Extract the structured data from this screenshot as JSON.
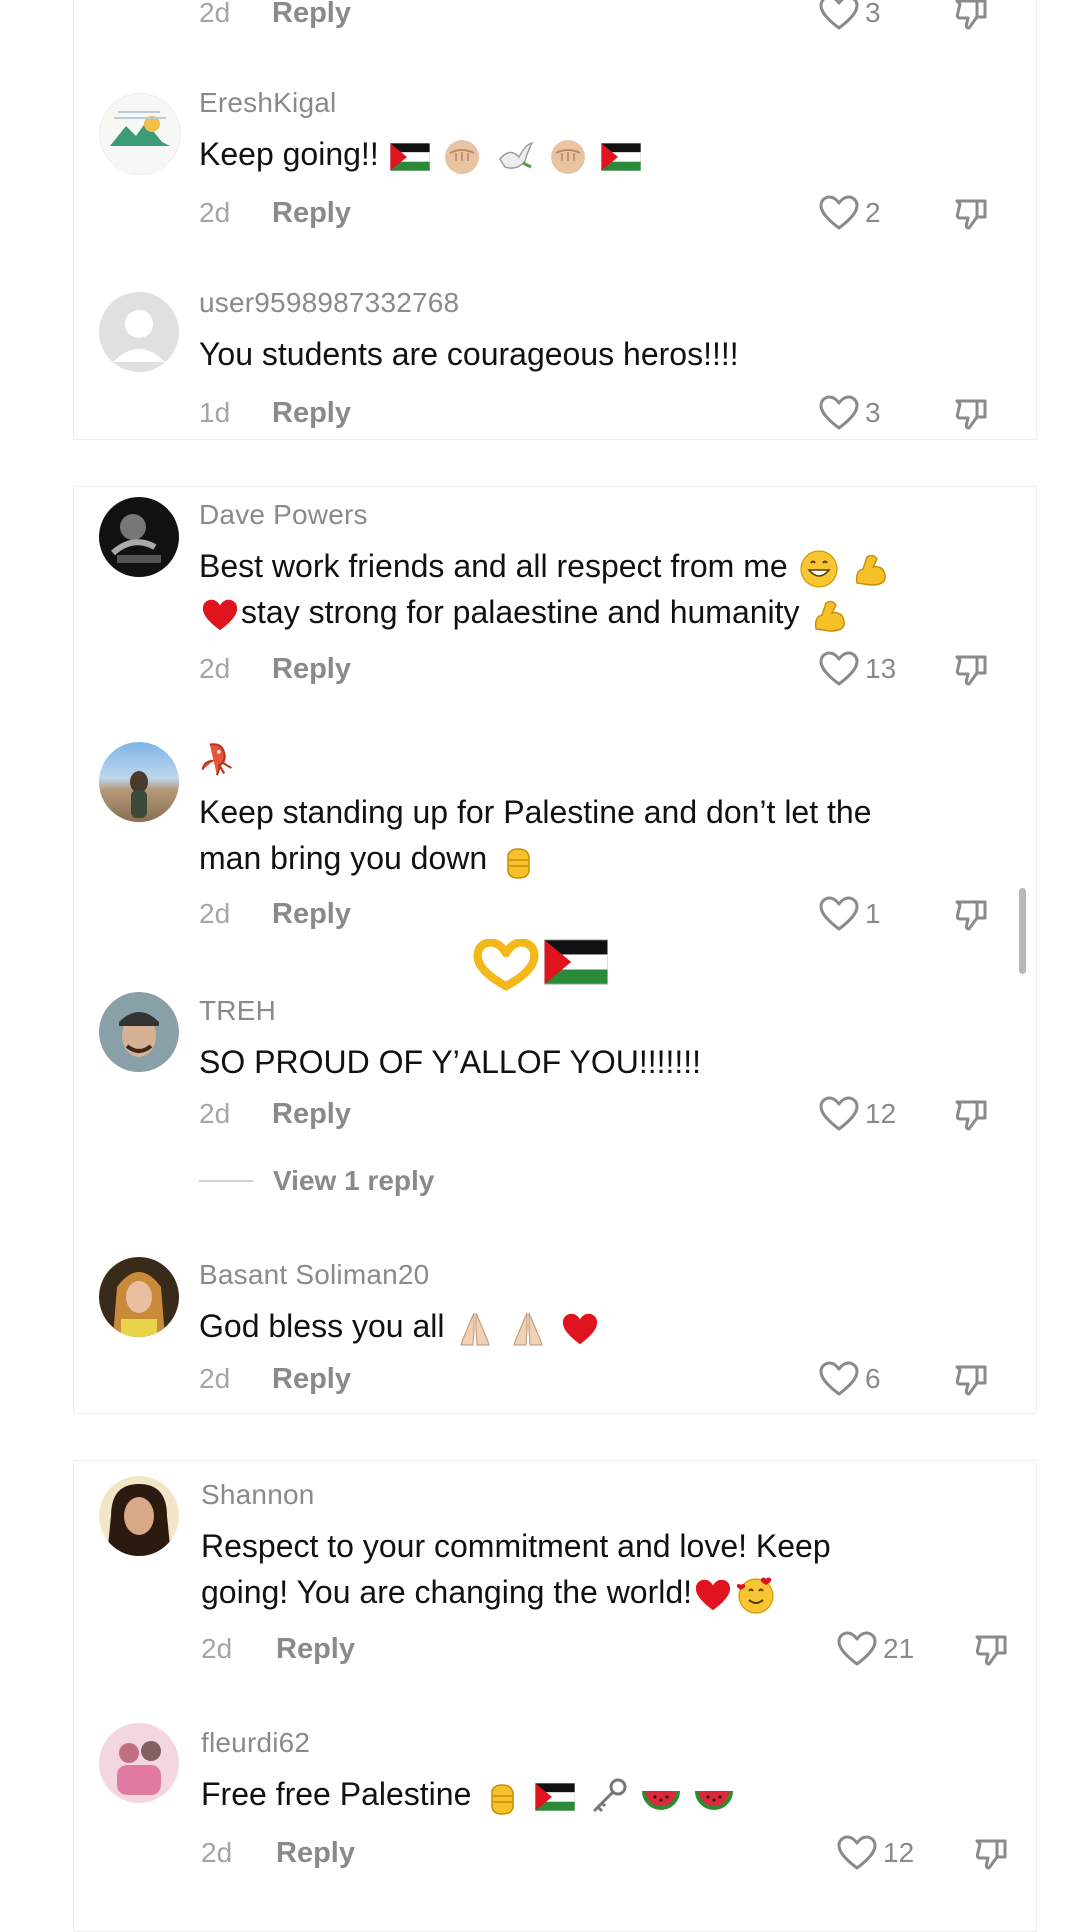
{
  "comments": [
    {
      "date": "2d",
      "reply": "Reply",
      "likes": "3"
    },
    {
      "user": "EreshKigal",
      "text": "Keep going!!",
      "date": "2d",
      "reply": "Reply",
      "likes": "2"
    },
    {
      "user": "user9598987332768",
      "text": "You students are courageous heros!!!!",
      "date": "1d",
      "reply": "Reply",
      "likes": "3"
    },
    {
      "user": "Dave Powers",
      "text1": "Best work friends and all respect from me",
      "text2": "stay strong for palaestine and humanity",
      "date": "2d",
      "reply": "Reply",
      "likes": "13"
    },
    {
      "text1": "Keep standing up for Palestine and don’t let the",
      "text2": "man bring you down",
      "date": "2d",
      "reply": "Reply",
      "likes": "1"
    },
    {
      "user": "TREH",
      "text": "SO PROUD OF Y’ALLOF YOU!!!!!!!",
      "date": "2d",
      "reply": "Reply",
      "likes": "12",
      "view_replies": "View 1 reply"
    },
    {
      "user": "Basant Soliman20",
      "text": "God bless you all",
      "date": "2d",
      "reply": "Reply",
      "likes": "6"
    },
    {
      "user": "Shannon",
      "text1": "Respect to your commitment and love! Keep",
      "text2": "going! You are changing the world!",
      "date": "2d",
      "reply": "Reply",
      "likes": "21"
    },
    {
      "user": "fleurdi62",
      "text": "Free free Palestine",
      "date": "2d",
      "reply": "Reply",
      "likes": "12"
    }
  ],
  "icons": {
    "like": "heart-outline-icon",
    "dislike": "thumbs-down-icon"
  },
  "colors": {
    "username": "#8a8a8a",
    "date": "#a5a5a5",
    "text": "#111111",
    "heart_red": "#e0141e"
  }
}
